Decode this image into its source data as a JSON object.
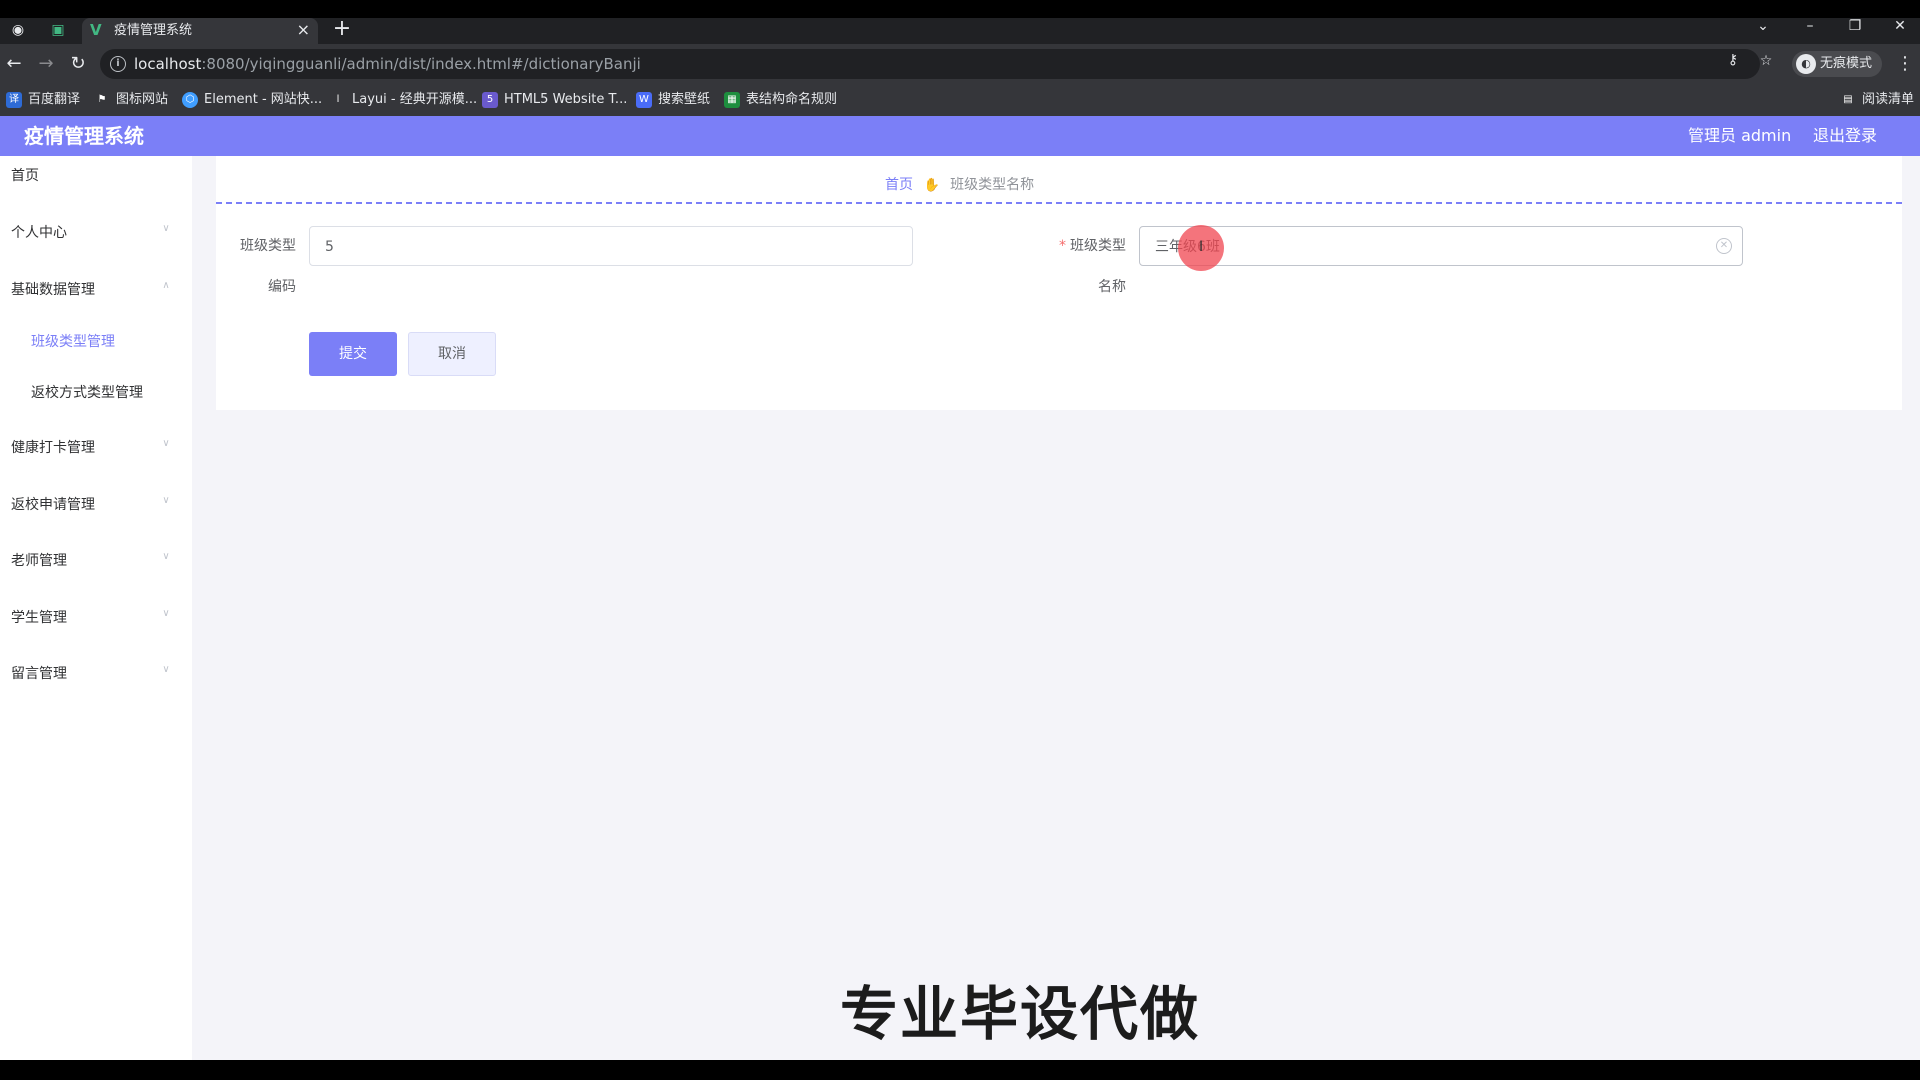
{
  "browser": {
    "tab_title": "疫情管理系统",
    "tab_close": "×",
    "new_tab": "+",
    "url_host": "localhost",
    "url_rest": ":8080/yiqingguanli/admin/dist/index.html#/dictionaryBanji",
    "profile_label": "无痕模式",
    "reading_list": "阅读清单",
    "bookmarks": [
      {
        "label": "百度翻译",
        "icon": "translate-icon",
        "color": "#2e6bd6"
      },
      {
        "label": "图标网站",
        "icon": "flag-icon",
        "color": "#5f6368"
      },
      {
        "label": "Element - 网站快...",
        "icon": "element-icon",
        "color": "#409eff"
      },
      {
        "label": "Layui - 经典开源模...",
        "icon": "layui-icon",
        "color": "#5f6368"
      },
      {
        "label": "HTML5 Website T...",
        "icon": "html5-icon",
        "color": "#6a5acd"
      },
      {
        "label": "搜索壁纸",
        "icon": "wallpaper-icon",
        "color": "#4a6cf7"
      },
      {
        "label": "表结构命名规则",
        "icon": "table-icon",
        "color": "#1e8e3e"
      }
    ]
  },
  "header": {
    "title": "疫情管理系统",
    "user": "管理员 admin",
    "logout": "退出登录"
  },
  "sidebar": {
    "items": [
      {
        "label": "首页",
        "expandable": false
      },
      {
        "label": "个人中心",
        "expandable": true
      },
      {
        "label": "基础数据管理",
        "expandable": true,
        "expanded": true
      },
      {
        "label": "班级类型管理",
        "sub": true,
        "active": true
      },
      {
        "label": "返校方式类型管理",
        "sub": true
      },
      {
        "label": "健康打卡管理",
        "expandable": true
      },
      {
        "label": "返校申请管理",
        "expandable": true
      },
      {
        "label": "老师管理",
        "expandable": true
      },
      {
        "label": "学生管理",
        "expandable": true
      },
      {
        "label": "留言管理",
        "expandable": true
      }
    ]
  },
  "breadcrumb": {
    "home": "首页",
    "current": "班级类型名称"
  },
  "form": {
    "code_label_1": "班级类型",
    "code_label_2": "编码",
    "code_value": "5",
    "name_required_mark": "*",
    "name_label_1": "班级类型",
    "name_label_2": "名称",
    "name_value": "三年级6班",
    "submit": "提交",
    "cancel": "取消"
  },
  "overlay": {
    "watermark": "专业毕设代做"
  },
  "colors": {
    "accent": "#7b7ff7",
    "required": "#f56c6c"
  }
}
